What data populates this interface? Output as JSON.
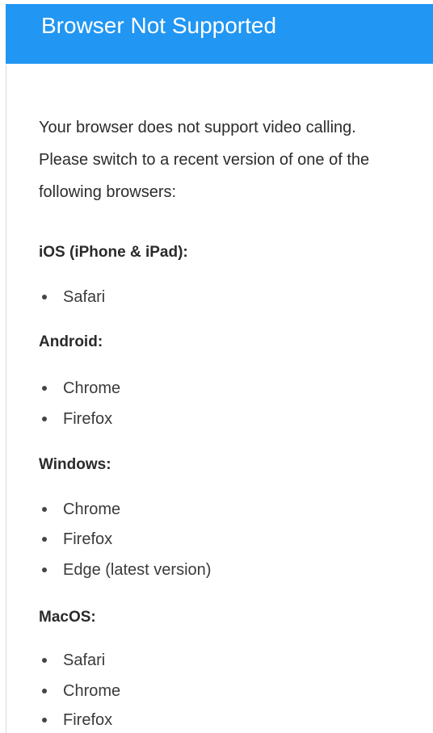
{
  "header": {
    "title": "Browser Not Supported",
    "background": "#2196f3"
  },
  "body": {
    "message": "Your browser does not support video calling.",
    "instruction": "Please switch to a recent version of one of the following browsers:"
  },
  "sections": [
    {
      "heading": "iOS (iPhone & iPad):",
      "browsers": [
        "Safari"
      ]
    },
    {
      "heading": "Android:",
      "browsers": [
        "Chrome",
        "Firefox"
      ]
    },
    {
      "heading": "Windows:",
      "browsers": [
        "Chrome",
        "Firefox",
        "Edge (latest version)"
      ]
    },
    {
      "heading": "MacOS:",
      "browsers": [
        "Safari",
        "Chrome",
        "Firefox"
      ]
    }
  ]
}
